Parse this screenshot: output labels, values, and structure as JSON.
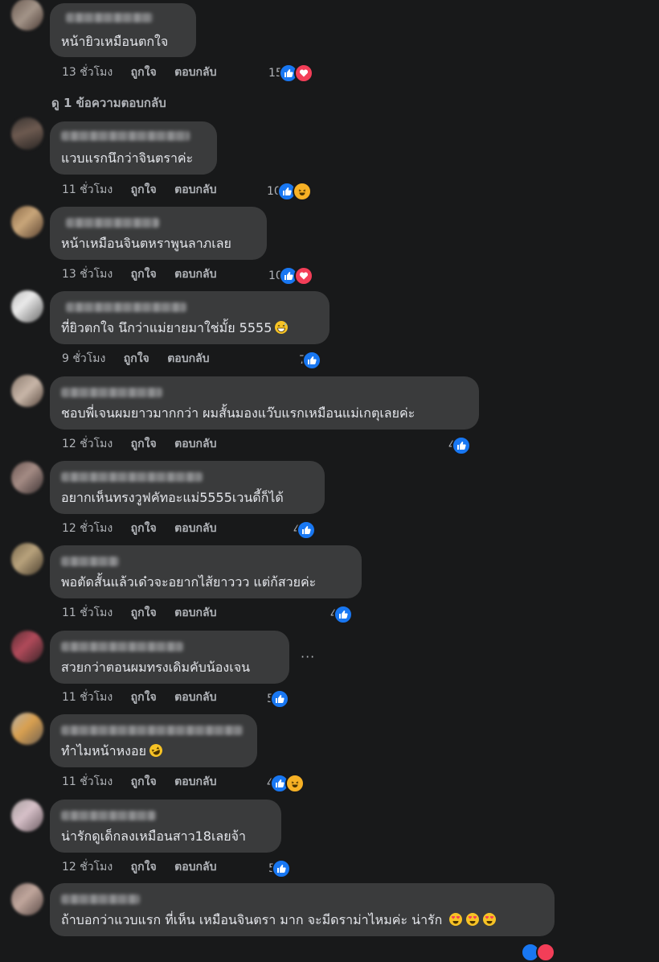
{
  "actions": {
    "like": "ถูกใจ",
    "reply": "ตอบกลับ"
  },
  "view_replies": "ดู 1 ข้อความตอบกลับ",
  "more_label": "···",
  "colors": {
    "like": "#1877f2",
    "love": "#f33e58",
    "haha": "#f7b125"
  },
  "comments": [
    {
      "text": "หน้ายิวเหมือนตกใจ",
      "time": "13 ชั่วโมง",
      "count": "15",
      "reactions": [
        "like-icon",
        "love-icon"
      ]
    },
    {
      "text": "แวบแรกนึกว่าจินตราค่ะ",
      "time": "11 ชั่วโมง",
      "count": "10",
      "reactions": [
        "like-icon",
        "haha-icon"
      ]
    },
    {
      "text": "หน้าเหมือนจินตหราพูนลาภเลย",
      "time": "13 ชั่วโมง",
      "count": "10",
      "reactions": [
        "like-icon",
        "love-icon"
      ]
    },
    {
      "text": "ที่ยิวตกใจ นึกว่าแม่ยายมาใช่มั้ย 5555",
      "time": "9 ชั่วโมง",
      "count": "7",
      "reactions": [
        "like-icon"
      ],
      "inline_emoji": "grin-sweat-emoji"
    },
    {
      "text": "ชอบพี่เจนผมยาวมากกว่า ผมสั้นมองแว๊บแรกเหมือนแม่เกตุเลยค่ะ",
      "time": "12 ชั่วโมง",
      "count": "4",
      "reactions": [
        "like-icon"
      ]
    },
    {
      "text": "อยากเห็นทรงวูฟคัทอะแม่5555เวนดี้ก็ได้",
      "time": "12 ชั่วโมง",
      "count": "4",
      "reactions": [
        "like-icon"
      ]
    },
    {
      "text": "พอตัดสั้นแล้วเด๋วจะอยากไส้ยาววว แต่ก้สวยค่ะ",
      "time": "11 ชั่วโมง",
      "count": "4",
      "reactions": [
        "like-icon"
      ]
    },
    {
      "text": "สวยกว่าตอนผมทรงเดิมคับน้องเจน",
      "time": "11 ชั่วโมง",
      "count": "5",
      "reactions": [
        "like-icon"
      ]
    },
    {
      "text": "ทำไมหน้าหงอย",
      "time": "11 ชั่วโมง",
      "count": "4",
      "reactions": [
        "like-icon",
        "haha-icon"
      ],
      "inline_emoji": "rofl-emoji"
    },
    {
      "text": "น่ารักดูเด็กลงเหมือนสาว18เลยจ้า",
      "time": "12 ชั่วโมง",
      "count": "5",
      "reactions": [
        "like-icon"
      ]
    },
    {
      "text": "ถ้าบอกว่าแวบแรก ที่เห็น เหมือนจินตรา มาก จะมีดราม่าไหมค่ะ น่ารัก",
      "time": "",
      "count": "",
      "reactions": [],
      "inline_emoji": "heart-eyes-emoji-x3"
    }
  ]
}
